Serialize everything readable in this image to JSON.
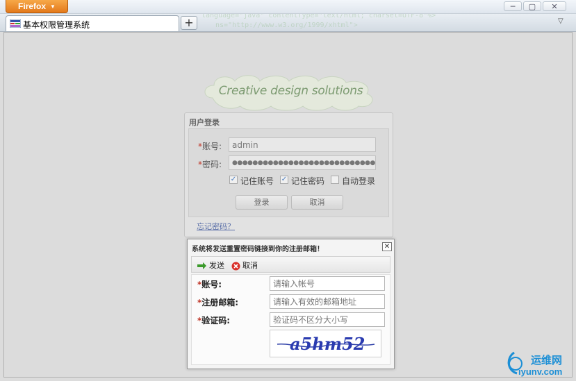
{
  "browser": {
    "menu_label": "Firefox",
    "tab_title": "基本权限管理系统",
    "new_tab_glyph": "+",
    "tab_list_glyph": "▽",
    "minimize_glyph": "─",
    "maximize_glyph": "▢",
    "close_glyph": "✕"
  },
  "logo": {
    "text": "Creative design solutions"
  },
  "login": {
    "heading": "用户登录",
    "account_label": "账号:",
    "account_value": "admin",
    "password_label": "密码:",
    "password_value": "●●●●●●●●●●●●●●●●●●●●●●●●●●●●●●",
    "remember_account": {
      "label": "记住账号",
      "checked": true
    },
    "remember_password": {
      "label": "记住密码",
      "checked": true
    },
    "auto_login": {
      "label": "自动登录",
      "checked": false
    },
    "login_button": "登录",
    "cancel_button": "取消",
    "forgot_link": "忘记密码？",
    "required_mark": "*"
  },
  "reset_dialog": {
    "title": "系统将发送重置密码链接到你的注册邮箱！",
    "close_glyph": "✕",
    "send_button": "发送",
    "cancel_button": "取消",
    "account_label": "账号:",
    "account_placeholder": "请输入帐号",
    "email_label": "注册邮箱:",
    "email_placeholder": "请输入有效的邮箱地址",
    "captcha_label": "验证码:",
    "captcha_placeholder": "验证码不区分大小写",
    "captcha_text": "a5hm52",
    "required_mark": "*"
  },
  "watermark": {
    "text": "运维网",
    "url": "iyunv.com"
  },
  "colors": {
    "firefox_orange": "#e3791b",
    "required_red": "#c0392b",
    "link_blue": "#5a6fa8",
    "logo_green": "#7d9b72",
    "send_green": "#3a9a2a",
    "cancel_red": "#d9302a",
    "watermark_blue": "#1c8fd6"
  }
}
